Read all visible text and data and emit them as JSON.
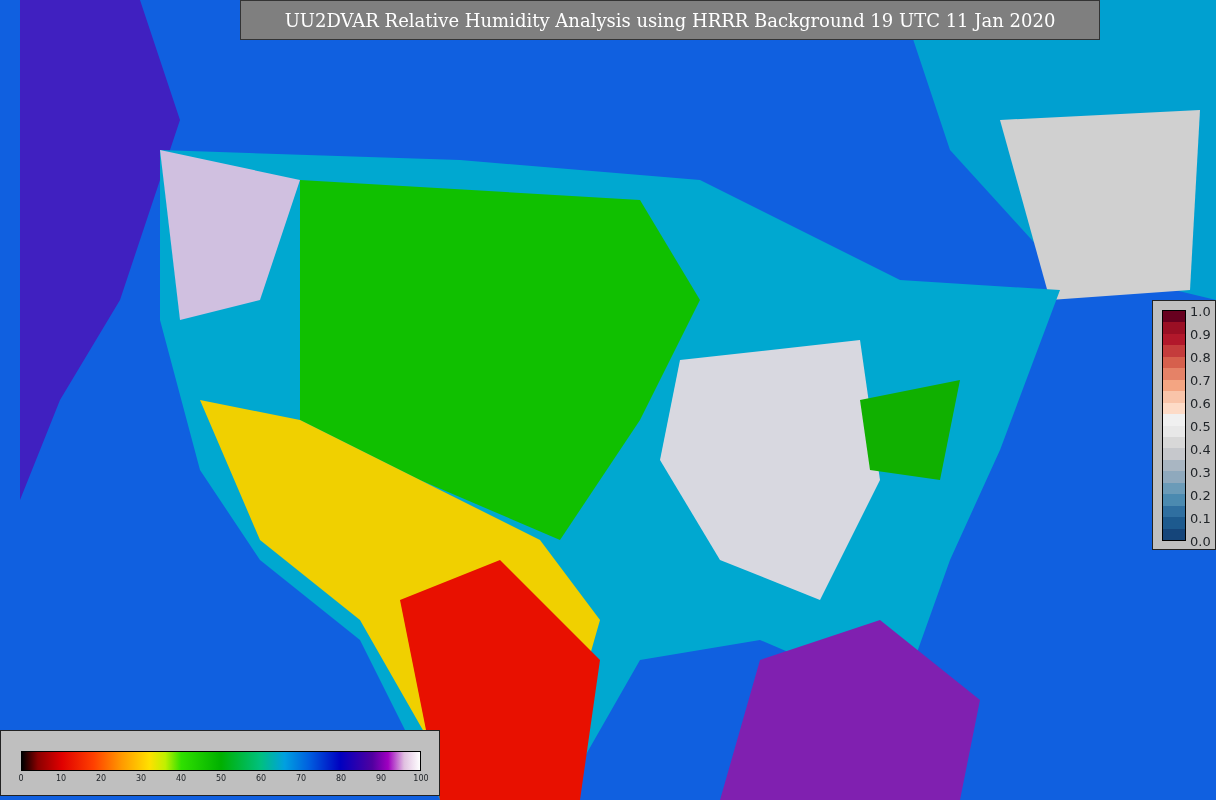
{
  "title": "UU2DVAR Relative Humidity Analysis using HRRR Background 19 UTC 11 Jan 2020",
  "humidity_colorbar": {
    "ticks": [
      "0",
      "10",
      "20",
      "30",
      "40",
      "50",
      "60",
      "70",
      "80",
      "90",
      "100"
    ]
  },
  "ratio_colorbar": {
    "ticks": [
      "1.0",
      "0.9",
      "0.8",
      "0.7",
      "0.6",
      "0.5",
      "0.4",
      "0.3",
      "0.2",
      "0.1",
      "0.0"
    ]
  }
}
